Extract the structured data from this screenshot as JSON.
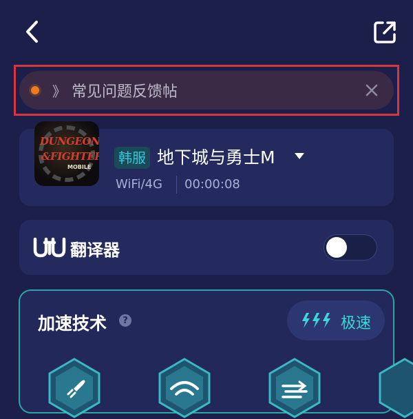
{
  "header": {
    "back_icon": "chevron-left-icon",
    "share_icon": "external-share-icon"
  },
  "notice": {
    "arrow": "》",
    "text": "常见问题反馈帖",
    "close_icon": "close-icon"
  },
  "game": {
    "logo_text_1": "DUNGEON",
    "logo_text_2": "&FIGHTER",
    "logo_text_3": "MOBILE",
    "region": "韩服",
    "title": "地下城与勇士M",
    "network": "WiFi/4G",
    "elapsed": "00:00:08"
  },
  "translator": {
    "label": "翻译器",
    "enabled": false
  },
  "acceleration": {
    "title": "加速技术",
    "speed_mode": "极速"
  },
  "colors": {
    "background": "#1b1f4a",
    "card": "#242a5e",
    "accent": "#3fd6d9",
    "highlight_outline": "#d8363f"
  }
}
